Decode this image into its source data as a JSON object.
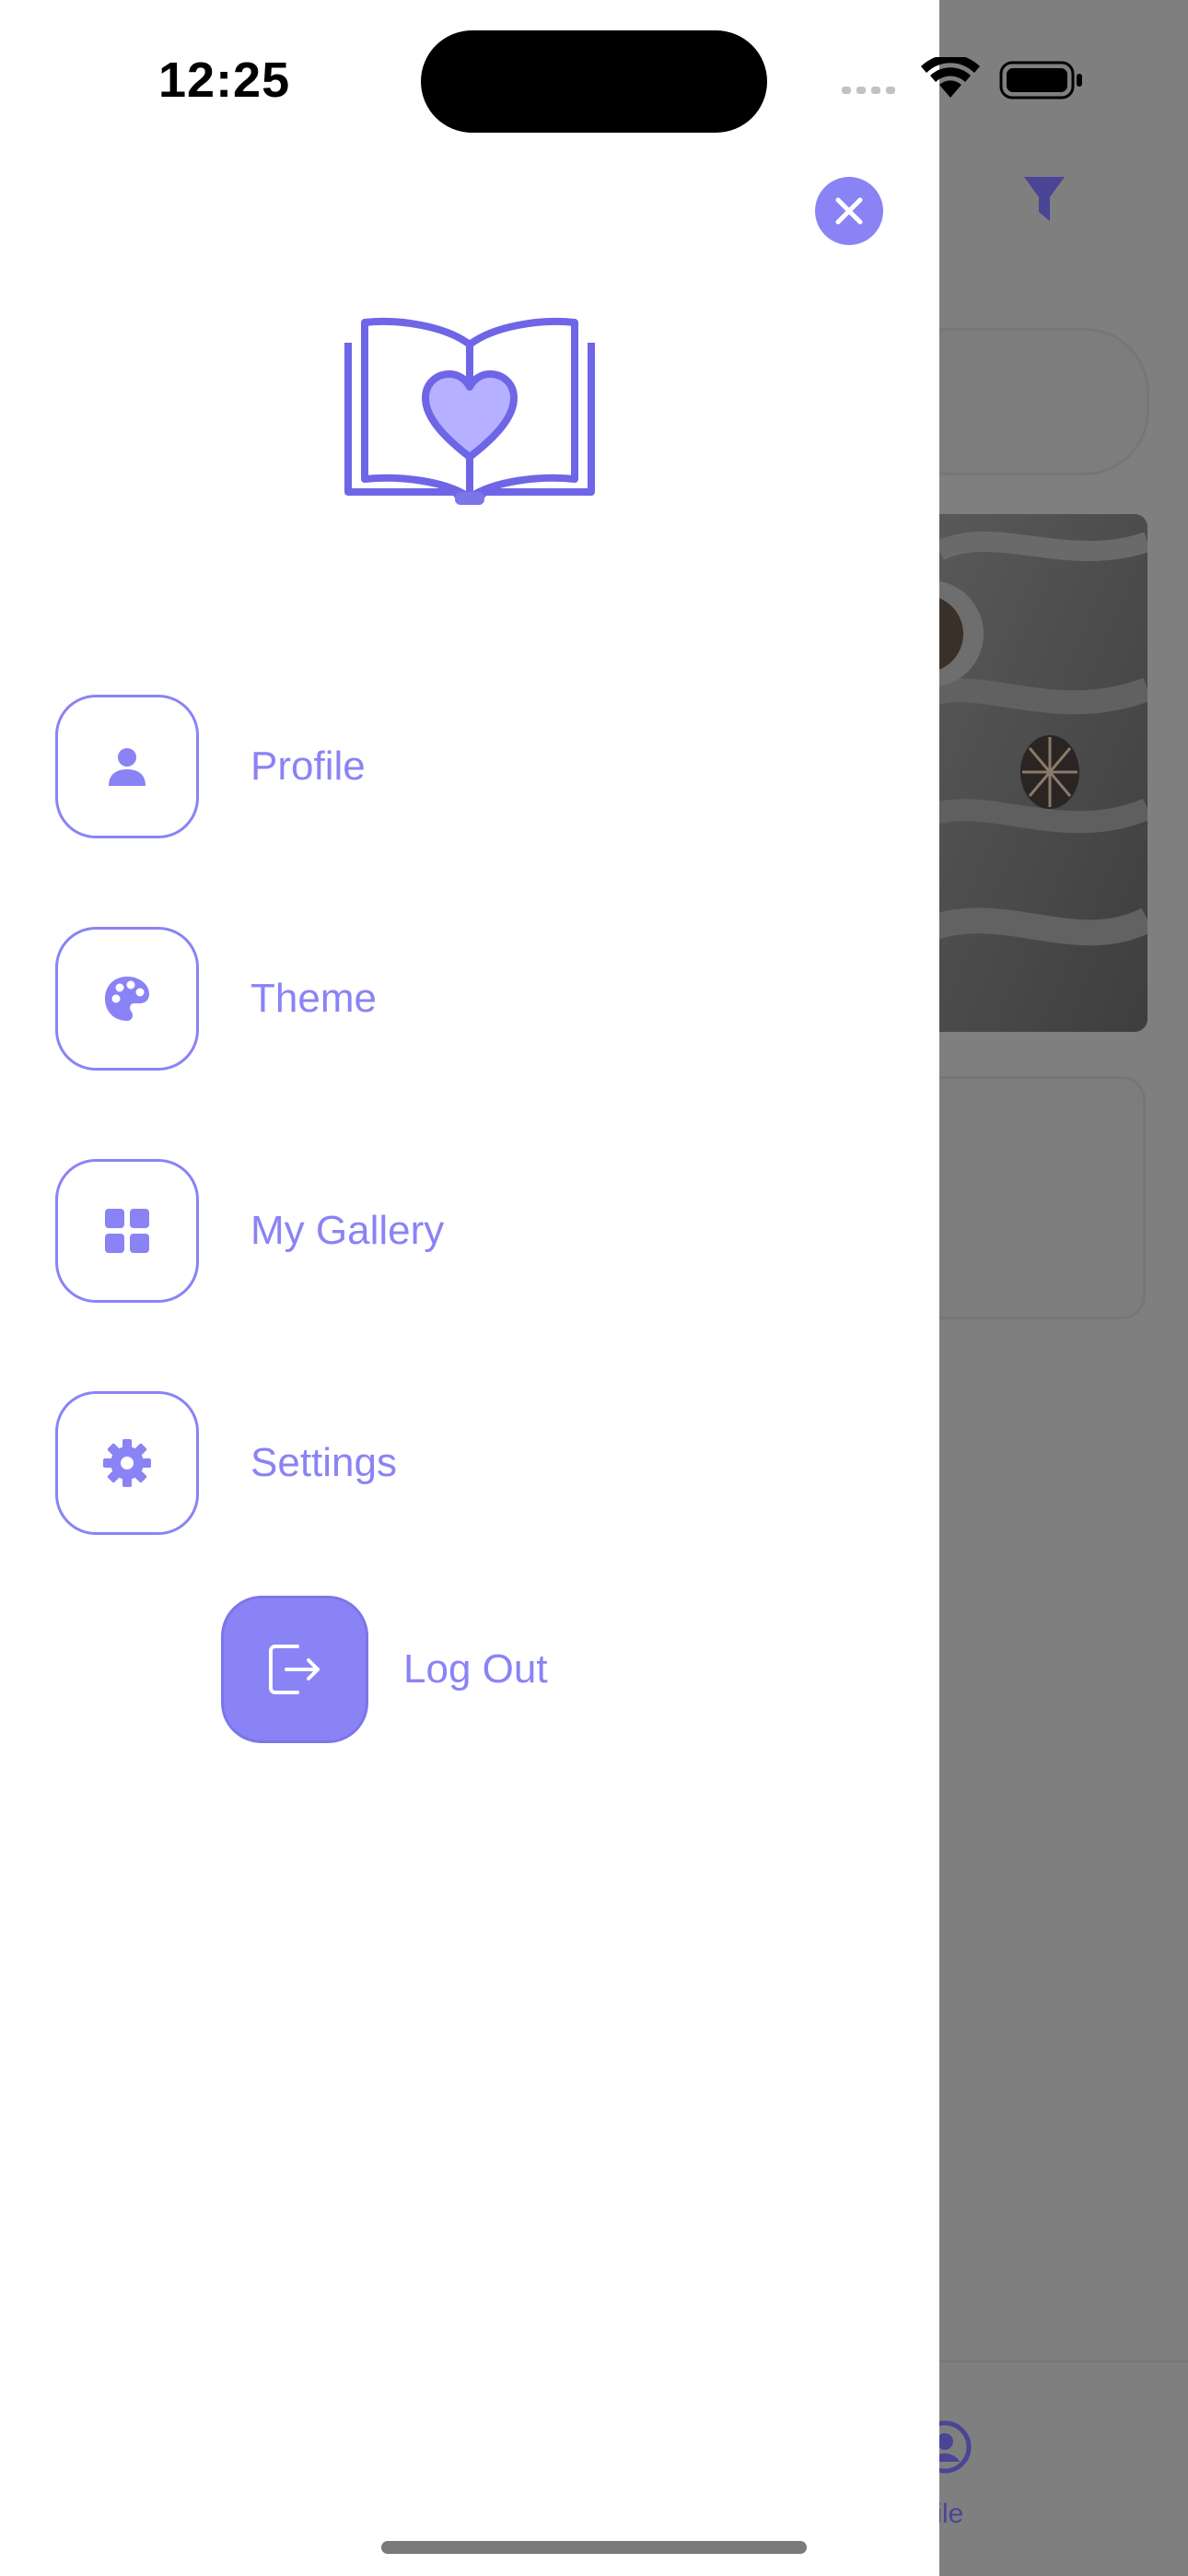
{
  "status_bar": {
    "time": "12:25"
  },
  "drawer": {
    "close_icon": "close-icon",
    "logo": "book-heart-logo",
    "menu_items": [
      {
        "label": "Profile",
        "icon": "person-icon"
      },
      {
        "label": "Theme",
        "icon": "palette-icon"
      },
      {
        "label": "My Gallery",
        "icon": "grid-icon"
      },
      {
        "label": "Settings",
        "icon": "gear-icon"
      }
    ],
    "logout": {
      "label": "Log Out",
      "icon": "logout-icon"
    }
  },
  "background": {
    "tab_label": "file"
  },
  "colors": {
    "accent": "#8a83f5",
    "scrim": "#808080",
    "drawer_bg": "#ffffff"
  }
}
